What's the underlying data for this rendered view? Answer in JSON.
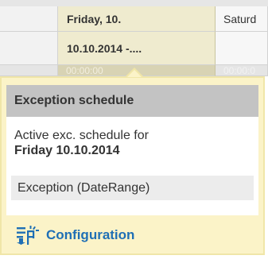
{
  "calendar": {
    "header_row": [
      "",
      "Friday, 10.",
      "Saturd"
    ],
    "date_row": [
      "",
      "10.10.2014 -....",
      ""
    ],
    "time_row": [
      "",
      "00:00:00",
      "00:00:0"
    ]
  },
  "popup": {
    "title": "Exception schedule",
    "info_line1": "Active exc. schedule for",
    "info_line2": "Friday 10.10.2014",
    "exception_item": "Exception (DateRange)",
    "config_link": "Configuration",
    "config_icon": "configuration-icon",
    "accent_color": "#1f6fb5",
    "popup_bg": "#fbf3c8"
  }
}
